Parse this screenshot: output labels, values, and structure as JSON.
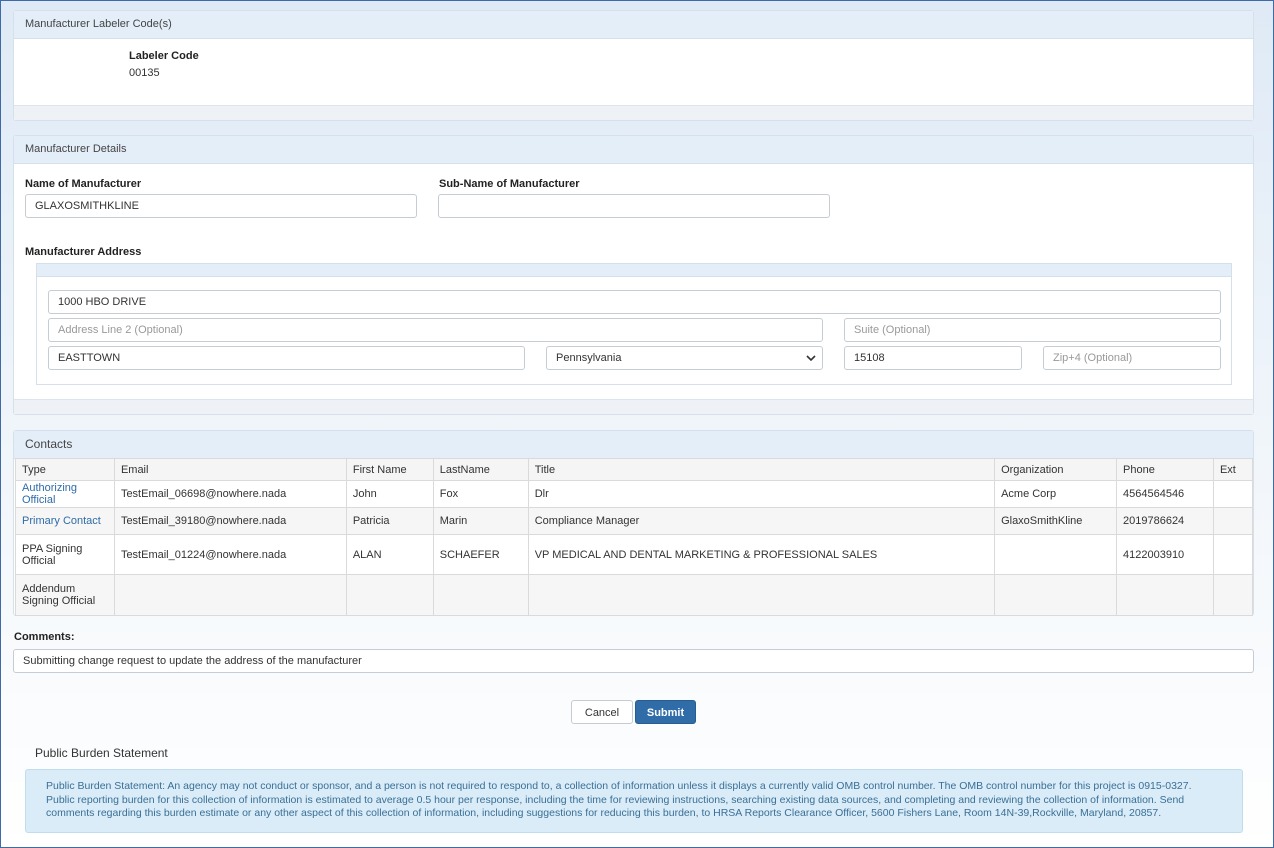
{
  "labeler_panel": {
    "title": "Manufacturer Labeler Code(s)",
    "code_label": "Labeler Code",
    "code_value": "00135"
  },
  "details_panel": {
    "title": "Manufacturer Details",
    "name_label": "Name of Manufacturer",
    "name_value": "GLAXOSMITHKLINE",
    "subname_label": "Sub-Name of Manufacturer",
    "subname_value": "",
    "address_label": "Manufacturer Address",
    "address": {
      "line1": "1000 HBO DRIVE",
      "line2_placeholder": "Address Line 2 (Optional)",
      "suite_placeholder": "Suite (Optional)",
      "city": "EASTTOWN",
      "state": "Pennsylvania",
      "zip": "15108",
      "zip4_placeholder": "Zip+4 (Optional)"
    }
  },
  "contacts_panel": {
    "title": "Contacts",
    "columns": [
      "Type",
      "Email",
      "First Name",
      "LastName",
      "Title",
      "Organization",
      "Phone",
      "Ext"
    ],
    "rows": [
      {
        "type": "Authorizing Official",
        "type_link": true,
        "email": "TestEmail_06698@nowhere.nada",
        "first": "John",
        "last": "Fox",
        "title": "Dlr",
        "org": "Acme Corp",
        "phone": "4564564546",
        "ext": ""
      },
      {
        "type": "Primary Contact",
        "type_link": true,
        "email": "TestEmail_39180@nowhere.nada",
        "first": "Patricia",
        "last": "Marin",
        "title": "Compliance Manager",
        "org": "GlaxoSmithKline",
        "phone": "2019786624",
        "ext": ""
      },
      {
        "type": "PPA Signing Official",
        "type_link": false,
        "email": "TestEmail_01224@nowhere.nada",
        "first": "ALAN",
        "last": "SCHAEFER",
        "title": "VP MEDICAL AND DENTAL MARKETING & PROFESSIONAL SALES",
        "org": "",
        "phone": "4122003910",
        "ext": ""
      },
      {
        "type": "Addendum Signing Official",
        "type_link": false,
        "email": "",
        "first": "",
        "last": "",
        "title": "",
        "org": "",
        "phone": "",
        "ext": ""
      }
    ]
  },
  "comments": {
    "label": "Comments:",
    "value": "Submitting change request to update the address of the manufacturer"
  },
  "actions": {
    "cancel_label": "Cancel",
    "submit_label": "Submit"
  },
  "burden": {
    "title": "Public Burden Statement",
    "text": "Public Burden Statement: An agency may not conduct or sponsor, and a person is not required to respond to, a collection of information unless it displays a currently valid OMB control number. The OMB control number for this project is 0915-0327. Public reporting burden for this collection of information is estimated to average 0.5 hour per response, including the time for reviewing instructions, searching existing data sources, and completing and reviewing the collection of information. Send comments regarding this burden estimate or any other aspect of this collection of information, including suggestions for reducing this burden, to HRSA Reports Clearance Officer, 5600 Fishers Lane, Room 14N-39,Rockville, Maryland, 20857."
  }
}
